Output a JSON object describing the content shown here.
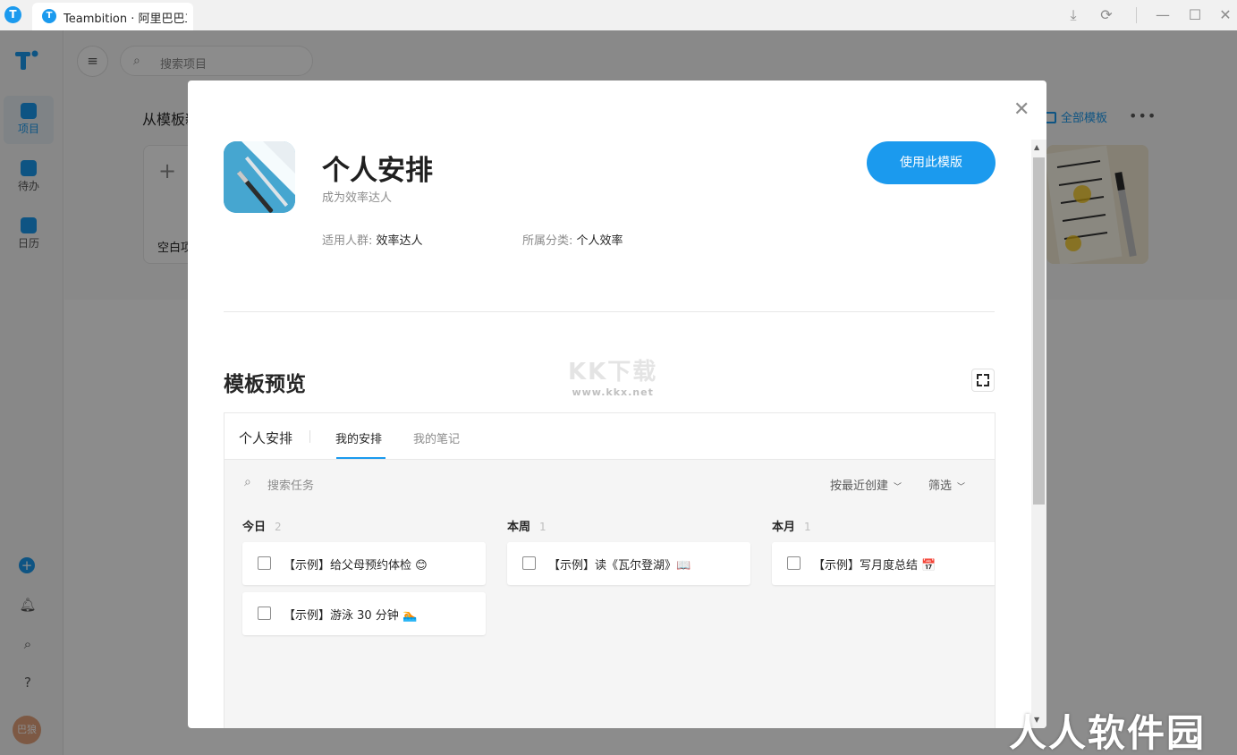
{
  "titlebar": {
    "tab_title": "Teambition · 阿里巴巴工",
    "icons": [
      "download-icon",
      "sync-icon",
      "minimize-icon",
      "maximize-icon",
      "close-icon"
    ]
  },
  "sidebar": {
    "items": [
      {
        "label": "项目",
        "icon": "project-icon",
        "active": true
      },
      {
        "label": "待办",
        "icon": "todo-icon",
        "active": false
      },
      {
        "label": "日历",
        "icon": "calendar-icon",
        "active": false
      }
    ],
    "avatar_text": "巴狼"
  },
  "background": {
    "search_placeholder": "搜索项目",
    "heading": "从模板新",
    "blank_card_label": "空白项",
    "all_templates": "全部模板"
  },
  "modal": {
    "title": "个人安排",
    "subtitle": "成为效率达人",
    "use_button": "使用此模版",
    "audience_key": "适用人群:",
    "audience_value": "效率达人",
    "category_key": "所属分类:",
    "category_value": "个人效率",
    "preview_title": "模板预览",
    "watermark_main": "KK下载",
    "watermark_sub": "www.kkx.net",
    "preview": {
      "project_name": "个人安排",
      "tabs": [
        {
          "label": "我的安排",
          "active": true
        },
        {
          "label": "我的笔记",
          "active": false
        }
      ],
      "search_placeholder": "搜索任务",
      "sort_label": "按最近创建",
      "filter_label": "筛选",
      "columns": [
        {
          "title": "今日",
          "count": "2",
          "tasks": [
            "【示例】给父母预约体检 😊",
            "【示例】游泳 30 分钟 🏊"
          ]
        },
        {
          "title": "本周",
          "count": "1",
          "tasks": [
            "【示例】读《瓦尔登湖》📖"
          ]
        },
        {
          "title": "本月",
          "count": "1",
          "tasks": [
            "【示例】写月度总结 📅"
          ]
        }
      ]
    }
  },
  "corner_watermark": "人人软件园",
  "colors": {
    "accent": "#1b9aee",
    "overlay": "rgba(0,0,0,0.45)"
  }
}
